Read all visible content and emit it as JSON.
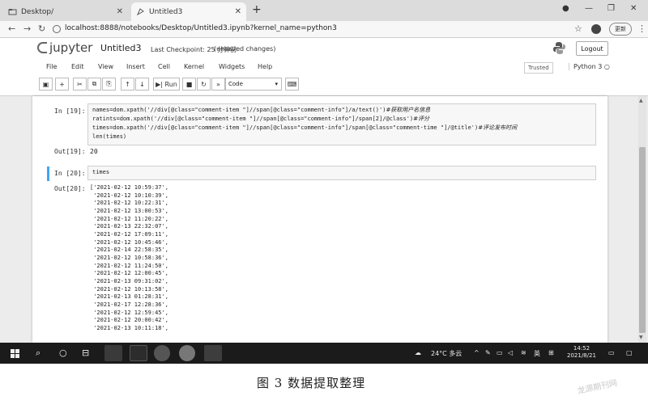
{
  "browser": {
    "tabs": [
      {
        "label": "Desktop/",
        "active": false
      },
      {
        "label": "Untitled3",
        "active": true
      }
    ],
    "url": "localhost:8888/notebooks/Desktop/Untitled3.ipynb?kernel_name=python3",
    "update_label": "更新",
    "new_tab_icon": "plus-icon"
  },
  "jupyter": {
    "logo_text": "jupyter",
    "notebook_name": "Untitled3",
    "checkpoint": "Last Checkpoint: 25 分钟前",
    "unsaved": "(unsaved changes)",
    "logout_label": "Logout",
    "menus": [
      "File",
      "Edit",
      "View",
      "Insert",
      "Cell",
      "Kernel",
      "Widgets",
      "Help"
    ],
    "trusted_label": "Trusted",
    "kernel_label": "Python 3",
    "run_label": "Run",
    "cell_type": "Code"
  },
  "cells": [
    {
      "in_prompt": "In  [19]:",
      "code_lines": [
        {
          "code": "names=dom.xpath('//div[@class=\"comment-item \"]//span[@class=\"comment-info\"]/a/text()')",
          "comment": "#获取用户名信息"
        },
        {
          "code": "ratints=dom.xpath('//div[@class=\"comment-item \"]//span[@class=\"comment-info\"]/span[2]/@class')",
          "comment": "#评分"
        },
        {
          "code": "times=dom.xpath('//div[@class=\"comment-item \"]//span[@class=\"comment-info\"]/span[@class=\"comment-time \"]/@title')",
          "comment": "#评论发布时间"
        },
        {
          "code": "len(times)",
          "comment": ""
        }
      ],
      "out_prompt": "Out[19]:",
      "output": "20"
    },
    {
      "in_prompt": "In  [20]:",
      "code_lines": [
        {
          "code": "times",
          "comment": ""
        }
      ],
      "out_prompt": "Out[20]:",
      "output_lines": [
        "['2021-02-12 10:59:37',",
        " '2021-02-12 10:10:39',",
        " '2021-02-12 10:22:31',",
        " '2021-02-12 13:00:53',",
        " '2021-02-12 11:20:22',",
        " '2021-02-13 22:32:07',",
        " '2021-02-12 17:09:11',",
        " '2021-02-12 10:45:46',",
        " '2021-02-14 22:58:35',",
        " '2021-02-12 10:58:36',",
        " '2021-02-12 11:24:50',",
        " '2021-02-12 12:00:45',",
        " '2021-02-13 09:31:02',",
        " '2021-02-12 10:13:58',",
        " '2021-02-13 01:28:31',",
        " '2021-02-17 12:28:36',",
        " '2021-02-12 12:59:45',",
        " '2021-02-12 20:00:42',",
        " '2021-02-13 10:11:18',"
      ]
    }
  ],
  "taskbar": {
    "weather": "24°C 多云",
    "ime": "英",
    "time": "14:52",
    "date": "2021/8/21"
  },
  "caption": "图 3    数据提取整理",
  "watermark": "龙源期刊网"
}
